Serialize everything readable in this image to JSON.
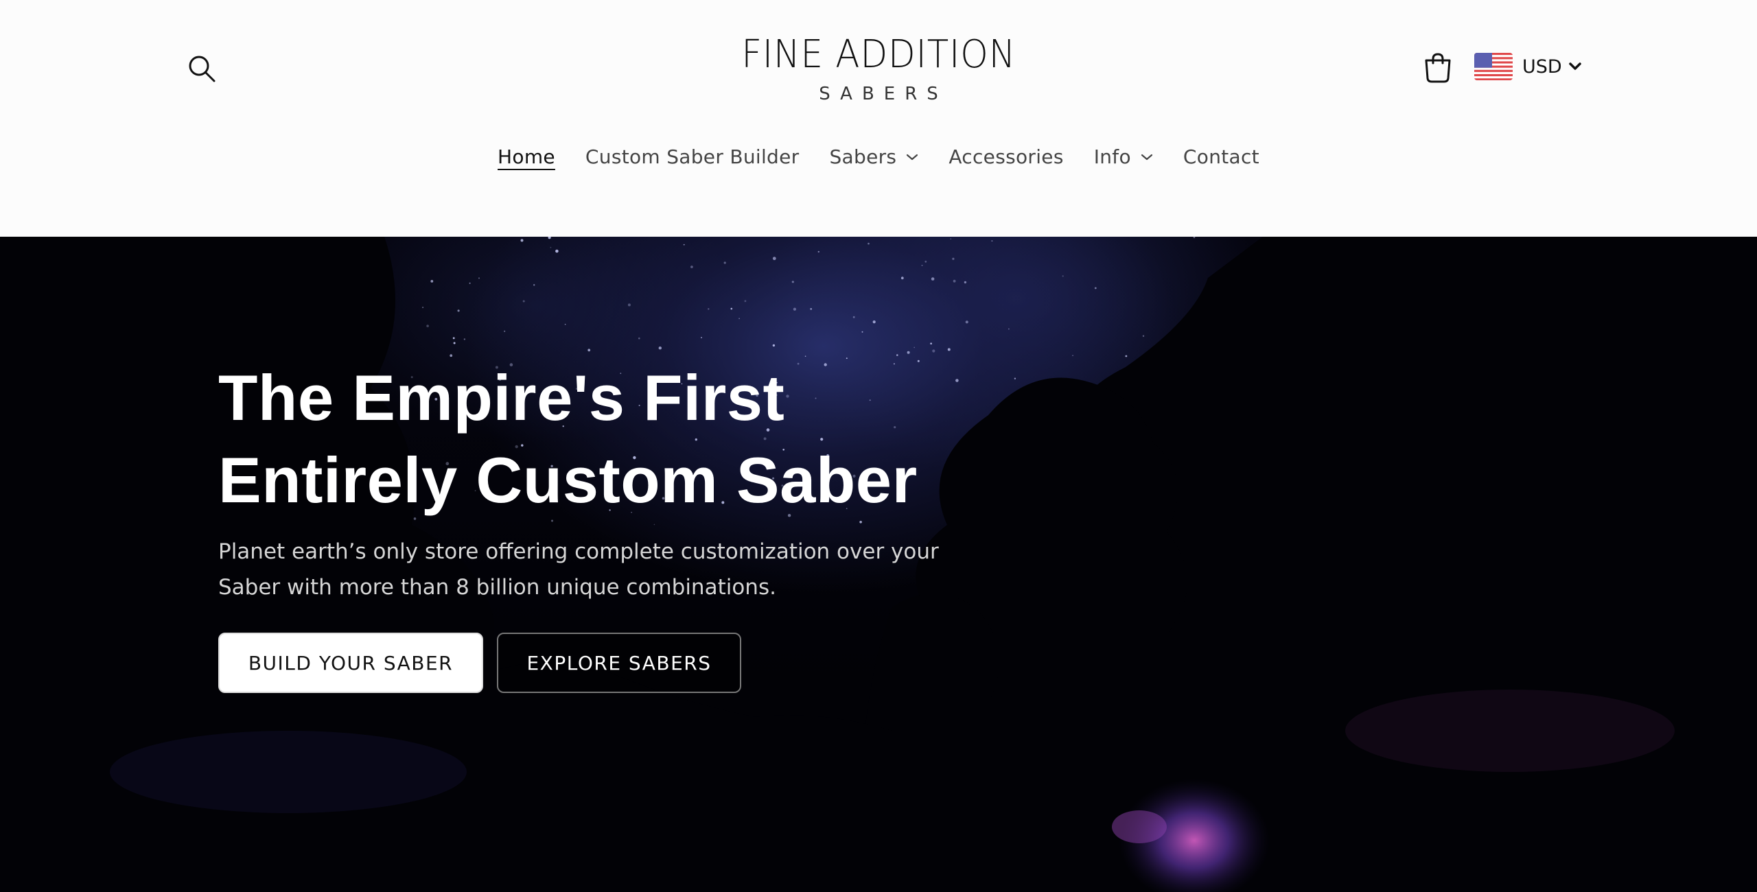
{
  "header": {
    "logo_main": "FINE ADDITION",
    "logo_sub": "SABERS",
    "currency_code": "USD",
    "icons": {
      "search": "search-icon",
      "cart": "shopping-bag-icon",
      "flag": "us-flag-icon",
      "caret": "chevron-down-icon"
    }
  },
  "nav": {
    "items": [
      {
        "label": "Home",
        "active": true,
        "has_dropdown": false
      },
      {
        "label": "Custom Saber Builder",
        "active": false,
        "has_dropdown": false
      },
      {
        "label": "Sabers",
        "active": false,
        "has_dropdown": true
      },
      {
        "label": "Accessories",
        "active": false,
        "has_dropdown": false
      },
      {
        "label": "Info",
        "active": false,
        "has_dropdown": true
      },
      {
        "label": "Contact",
        "active": false,
        "has_dropdown": false
      }
    ]
  },
  "hero": {
    "title_line1": "The Empire's First",
    "title_line2": "Entirely Custom Saber",
    "subtitle": "Planet earth’s only store offering complete customization over your Saber with more than 8 billion unique combinations.",
    "primary_button": "BUILD YOUR SABER",
    "secondary_button": "EXPLORE SABERS"
  },
  "colors": {
    "header_bg": "#fcfcfc",
    "hero_bg": "#03030a",
    "text_dark": "#111111",
    "nav_text": "#444444"
  }
}
